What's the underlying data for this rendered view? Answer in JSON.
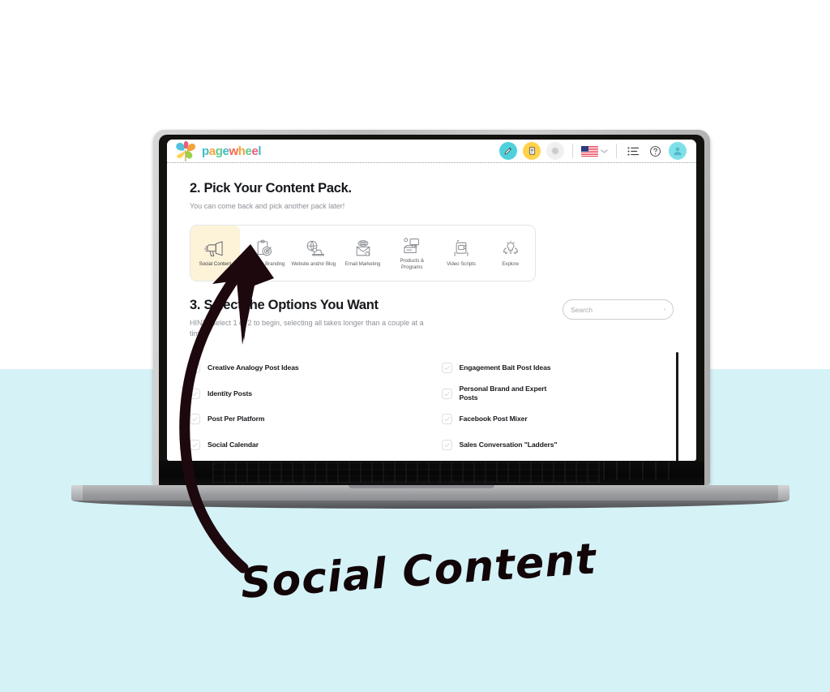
{
  "colors": {
    "bg_top": "#ffffff",
    "bg_bottom": "#d5f2f7",
    "active_tab_bg": "#fcf3d9",
    "accent_teal": "#4fd1db",
    "accent_yellow": "#ffd24a",
    "ink": "#16181c",
    "arrow": "#1d080e"
  },
  "app": {
    "header": {
      "logo_text": "pagewheel",
      "logo_icon": "pinwheel-logo",
      "logo_letters": [
        {
          "char": "p",
          "color": "#3fb9c8"
        },
        {
          "char": "a",
          "color": "#f5a33c"
        },
        {
          "char": "g",
          "color": "#5fc98f"
        },
        {
          "char": "e",
          "color": "#3fb9c8"
        },
        {
          "char": "w",
          "color": "#f5684f"
        },
        {
          "char": "h",
          "color": "#f5a33c"
        },
        {
          "char": "e",
          "color": "#5fc98f"
        },
        {
          "char": "e",
          "color": "#ef5b78"
        },
        {
          "char": "l",
          "color": "#3fb9c8"
        }
      ],
      "actions": [
        {
          "name": "edit-pencil-button",
          "icon": "pencil-icon",
          "style": "teal"
        },
        {
          "name": "library-book-button",
          "icon": "book-icon",
          "style": "yellow"
        },
        {
          "name": "settings-button",
          "icon": "gear-icon",
          "style": "grey"
        },
        {
          "name": "language-selector",
          "icon": "us-flag-icon",
          "style": "flag",
          "chevron": "chevron-down-icon"
        },
        {
          "name": "menu-list-button",
          "icon": "list-icon",
          "style": "plain"
        },
        {
          "name": "help-button",
          "icon": "question-circle-icon",
          "style": "plain"
        },
        {
          "name": "user-avatar",
          "icon": "person-icon",
          "style": "avatar"
        }
      ]
    },
    "step2": {
      "title": "2. Pick Your Content Pack.",
      "subtitle": "You can come back and pick another pack later!"
    },
    "packs": [
      {
        "label": "Social Content",
        "icon": "megaphone-icon",
        "active": true
      },
      {
        "label": "Business Branding",
        "icon": "clipboard-target-icon",
        "active": false
      },
      {
        "label": "Website and/or Blog",
        "icon": "globe-laptop-icon",
        "active": false
      },
      {
        "label": "Email Marketing",
        "icon": "envelope-icon",
        "active": false
      },
      {
        "label": "Products & Programs",
        "icon": "product-box-icon",
        "active": false
      },
      {
        "label": "Video Scripts",
        "icon": "video-camera-icon",
        "active": false
      },
      {
        "label": "Explore",
        "icon": "lightbulb-hands-icon",
        "active": false
      }
    ],
    "step3": {
      "title": "3. Select the Options You Want",
      "subtitle": "HINT! Select 1 or 2 to begin, selecting all takes longer than a couple at a time."
    },
    "search": {
      "placeholder": "Search",
      "value": "",
      "icon": "search-icon"
    },
    "options": {
      "left_column": [
        {
          "label": "Creative Analogy Post Ideas",
          "checked": false
        },
        {
          "label": "Identity Posts",
          "checked": false
        },
        {
          "label": "Post Per Platform",
          "checked": false
        },
        {
          "label": "Social Calendar",
          "checked": false
        }
      ],
      "right_column": [
        {
          "label": "Engagement Bait Post Ideas",
          "checked": false
        },
        {
          "label": "Personal Brand and Expert Posts",
          "checked": false
        },
        {
          "label": "Facebook Post Mixer",
          "checked": false
        },
        {
          "label": "Sales Conversation \"Ladders\"",
          "checked": false
        }
      ]
    }
  },
  "annotation": {
    "caption": "Social Content",
    "arrow": "curved-arrow-up"
  }
}
